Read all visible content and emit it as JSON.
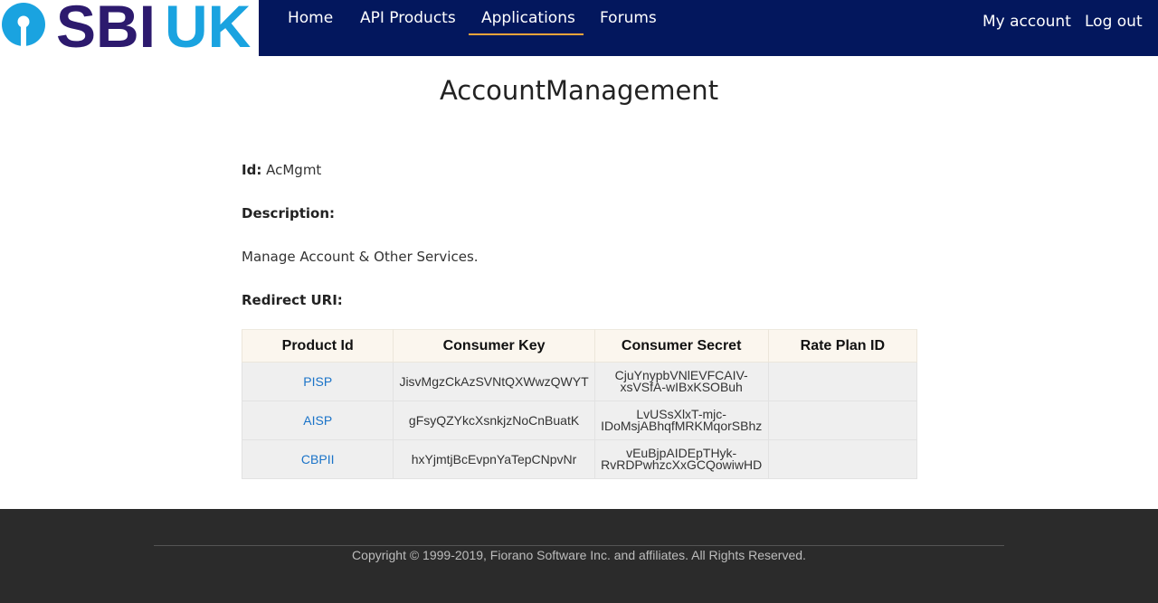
{
  "brand": {
    "logo_text_sbi": "SBI",
    "logo_text_uk": "UK",
    "colors": {
      "navy": "#03175d",
      "cyan": "#1aa3e0",
      "purple": "#2d1a6e",
      "accent": "#f0a43a"
    }
  },
  "nav": {
    "items": [
      {
        "label": "Home"
      },
      {
        "label": "API Products"
      },
      {
        "label": "Applications"
      },
      {
        "label": "Forums"
      }
    ],
    "active": "Applications",
    "right": [
      {
        "label": "My account"
      },
      {
        "label": "Log out"
      }
    ]
  },
  "app": {
    "title": "AccountManagement",
    "id_label": "Id:",
    "id_value": "AcMgmt",
    "description_label": "Description:",
    "description_value": "Manage Account & Other Services.",
    "redirect_label": "Redirect URI:"
  },
  "table": {
    "headers": [
      "Product Id",
      "Consumer Key",
      "Consumer Secret",
      "Rate Plan ID"
    ],
    "rows": [
      {
        "product_id": "PISP",
        "consumer_key": "JisvMgzCkAzSVNtQXWwzQWYT",
        "consumer_secret_1": "CjuYnypbVNlEVFCAIV-",
        "consumer_secret_2": "xsVSfA-wIBxKSOBuh",
        "rate_plan_id": ""
      },
      {
        "product_id": "AISP",
        "consumer_key": "gFsyQZYkcXsnkjzNoCnBuatK",
        "consumer_secret_1": "LvUSsXlxT-mjc-",
        "consumer_secret_2": "IDoMsjABhqfMRKMqorSBhz",
        "rate_plan_id": ""
      },
      {
        "product_id": "CBPII",
        "consumer_key": "hxYjmtjBcEvpnYaTepCNpvNr",
        "consumer_secret_1": "vEuBjpAIDEpTHyk-",
        "consumer_secret_2": "RvRDPwhzcXxGCQowiwHD",
        "rate_plan_id": ""
      }
    ]
  },
  "footer": {
    "copyright": "Copyright © 1999-2019, Fiorano Software Inc. and affiliates. All Rights Reserved."
  }
}
